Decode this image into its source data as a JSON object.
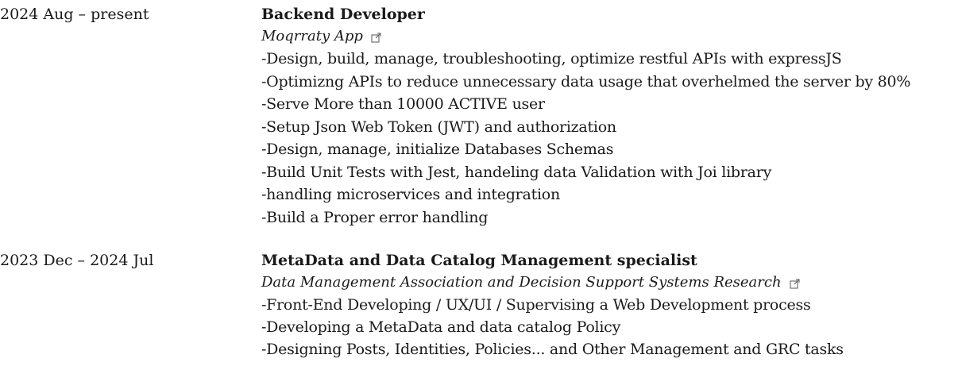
{
  "experience": [
    {
      "date": "2024 Aug – present",
      "role": "Backend Developer",
      "organization": "Moqrraty App",
      "link_icon": "external-link-icon",
      "bullets": [
        "-Design, build, manage, troubleshooting, optimize restful APIs with expressJS",
        "-Optimizng APIs to reduce unnecessary data usage that overhelmed the server by 80%",
        "-Serve More than 10000 ACTIVE user",
        "-Setup Json Web Token (JWT) and authorization",
        "-Design, manage, initialize Databases Schemas",
        "-Build Unit Tests with Jest, handeling data Validation with Joi library",
        "-handling microservices and integration",
        "-Build a Proper error handling"
      ]
    },
    {
      "date": "2023 Dec – 2024 Jul",
      "role": "MetaData and Data Catalog Management specialist",
      "organization": "Data Management Association and Decision Support Systems Research",
      "link_icon": "external-link-icon",
      "bullets": [
        "-Front-End Developing / UX/UI / Supervising a Web Development process",
        "-Developing a MetaData and data catalog Policy",
        "-Designing Posts, Identities, Policies... and Other Management and GRC tasks"
      ]
    }
  ]
}
